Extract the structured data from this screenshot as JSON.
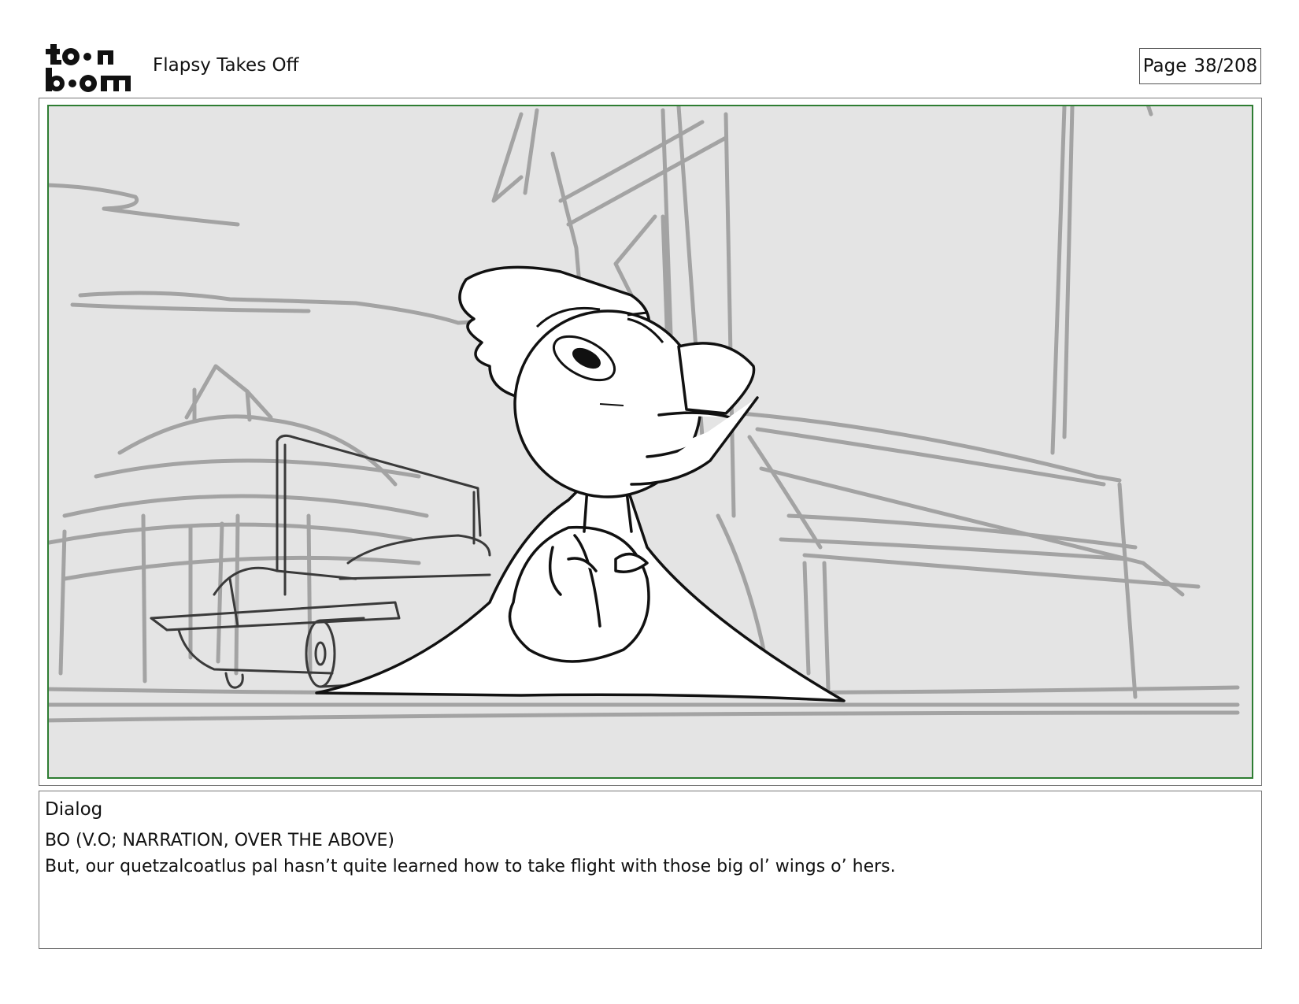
{
  "header": {
    "logo_alt": "toon boom",
    "title": "Flapsy Takes Off",
    "page_label": "Page",
    "page_number": "38/208"
  },
  "panel": {
    "frame_color": "#2e7d32",
    "background_color": "#e4e4e4"
  },
  "dialog": {
    "heading": "Dialog",
    "speaker": "BO (V.O; NARRATION, OVER THE ABOVE)",
    "line": "But, our quetzalcoatlus pal hasn’t quite learned how to take flight with those big ol’ wings o’ hers."
  }
}
